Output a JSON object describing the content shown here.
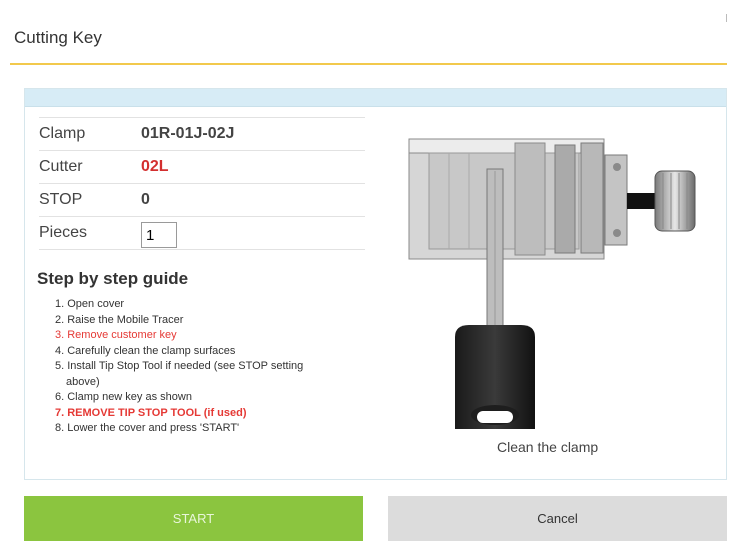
{
  "header": {
    "title": "Cutting Key"
  },
  "info": {
    "clamp_label": "Clamp",
    "clamp_value": "01R-01J-02J",
    "cutter_label": "Cutter",
    "cutter_value": "02L",
    "stop_label": "STOP",
    "stop_value": "0",
    "pieces_label": "Pieces",
    "pieces_value": "1"
  },
  "guide": {
    "title": "Step by step guide",
    "steps": [
      "1. Open cover",
      "2. Raise the Mobile Tracer",
      "3. Remove customer key",
      "4. Carefully clean the clamp surfaces",
      "5. Install Tip Stop Tool if needed (see STOP setting",
      "above)",
      "6. Clamp new key as shown",
      "7. REMOVE TIP STOP TOOL (if used)",
      "8. Lower the cover and press 'START'"
    ]
  },
  "image": {
    "caption": "Clean the clamp",
    "icon": "clamp-with-key-illustration"
  },
  "buttons": {
    "start": "START",
    "cancel": "Cancel"
  },
  "colors": {
    "accent_line": "#f2c94c",
    "start_button": "#8bc53f",
    "warning_text": "#e53935",
    "panel_bar": "#d7ecf6"
  }
}
